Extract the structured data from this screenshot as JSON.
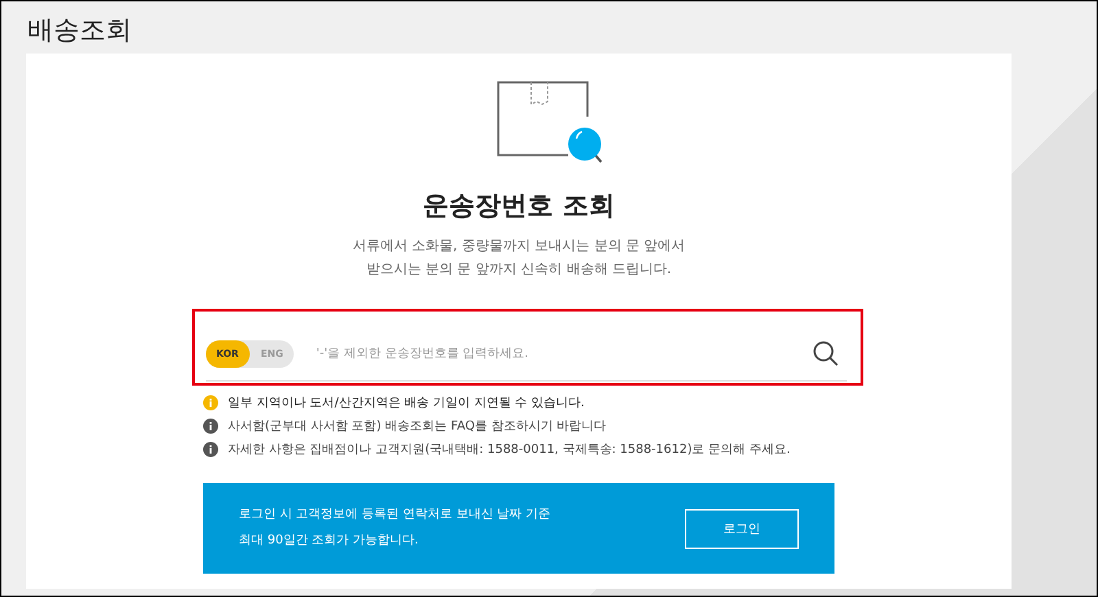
{
  "page_title": "배송조회",
  "heading": "운송장번호 조회",
  "description": [
    "서류에서 소화물, 중량물까지 보내시는 분의 문 앞에서",
    "받으시는 분의 문 앞까지 신속히 배송해 드립니다."
  ],
  "language_toggle": [
    {
      "label": "KOR",
      "selected": true
    },
    {
      "label": "ENG",
      "selected": false
    }
  ],
  "search": {
    "placeholder": "'-'을 제외한 운송장번호를 입력하세요."
  },
  "notices": [
    {
      "kind": "warning",
      "text": "일부 지역이나 도서/산간지역은 배송 기일이 지연될 수 있습니다."
    },
    {
      "kind": "info",
      "text": "사서함(군부대 사서함 포함) 배송조회는 FAQ를 참조하시기 바랍니다"
    },
    {
      "kind": "info",
      "text": "자세한 사항은 집배점이나 고객지원(국내택배: 1588-0011, 국제특송: 1588-1612)로 문의해 주세요."
    }
  ],
  "login_banner": {
    "lines": [
      "로그인 시 고객정보에 등록된 연락처로 보내신 날짜 기준",
      "최대 90일간 조회가 가능합니다."
    ],
    "button": "로그인"
  }
}
